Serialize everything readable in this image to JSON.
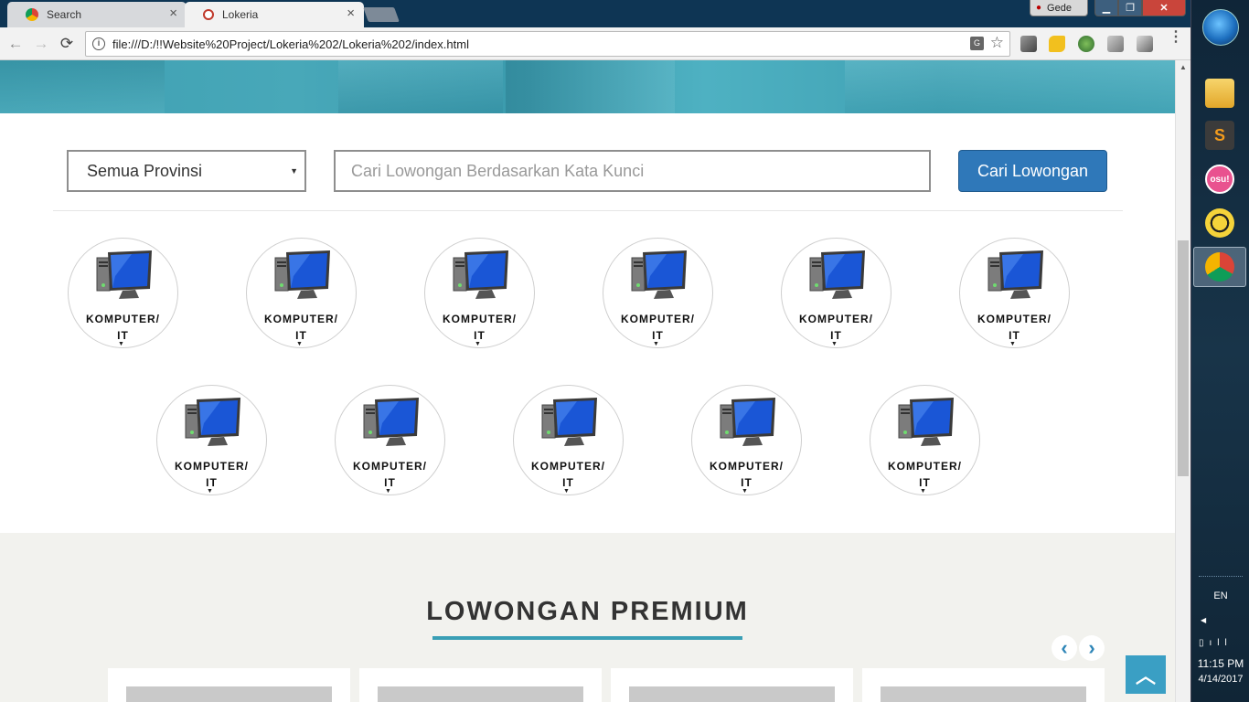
{
  "browser": {
    "tabs": [
      {
        "label": "Search",
        "active": false
      },
      {
        "label": "Lokeria",
        "active": true
      }
    ],
    "tab_close_glyph": "×",
    "profile_name": "Gede",
    "window_buttons": {
      "minimize": "▁",
      "maximize": "❐",
      "close": "✕"
    },
    "url": "file:///D:/!!Website%20Project/Lokeria%202/Lokeria%202/index.html",
    "nav": {
      "back": "←",
      "forward": "→",
      "reload": "⟳",
      "info": "i",
      "star": "☆",
      "translate": "G",
      "menu": "⋮"
    },
    "extension_icons": [
      "extension-tool-icon",
      "extension-cheese-icon",
      "extension-globe-icon",
      "extension-cube-icon",
      "extension-cube2-icon"
    ]
  },
  "search": {
    "province_select": "Semua Provinsi",
    "province_caret": "▼",
    "keyword_placeholder": "Cari Lowongan Berdasarkan Kata Kunci",
    "button_label": "Cari Lowongan"
  },
  "categories": {
    "row1": [
      "KOMPUTER/\nIT",
      "KOMPUTER/\nIT",
      "KOMPUTER/\nIT",
      "KOMPUTER/\nIT",
      "KOMPUTER/\nIT",
      "KOMPUTER/\nIT"
    ],
    "row2": [
      "KOMPUTER/\nIT",
      "KOMPUTER/\nIT",
      "KOMPUTER/\nIT",
      "KOMPUTER/\nIT",
      "KOMPUTER/\nIT"
    ],
    "caret": "▼",
    "icon": "computer-monitor-icon"
  },
  "premium": {
    "title": "LOWONGAN PREMIUM",
    "prev": "‹",
    "next": "›",
    "card_count": 4,
    "back_to_top": "︿"
  },
  "colors": {
    "hero_teal": "#43a6b8",
    "search_button": "#2f78b9",
    "accent_underline": "#3a9fb5",
    "premium_bg": "#f2f2ee",
    "back_to_top": "#3a9fc4"
  },
  "taskbar": {
    "apps": [
      {
        "name": "file-explorer-icon",
        "label": "",
        "active": false
      },
      {
        "name": "sublime-text-icon",
        "label": "S",
        "active": false
      },
      {
        "name": "osu-icon",
        "label": "osu!",
        "active": false
      },
      {
        "name": "bee-app-icon",
        "label": "",
        "active": false
      },
      {
        "name": "chrome-icon",
        "label": "",
        "active": true
      }
    ],
    "language": "EN",
    "tray_expand": "◀",
    "tray_icons": "▯ıll",
    "time": "11:15 PM",
    "date": "4/14/2017"
  }
}
